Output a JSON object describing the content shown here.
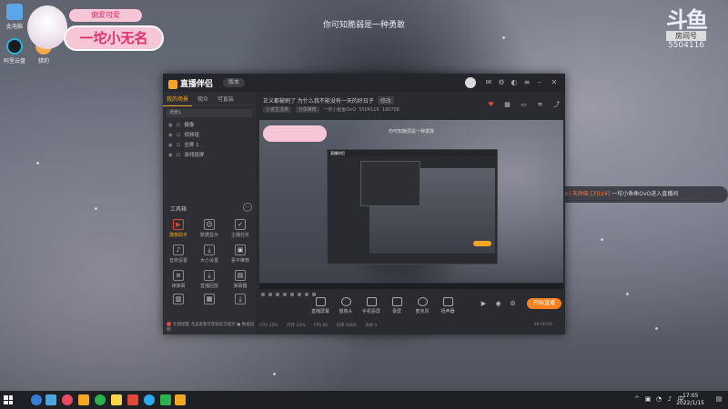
{
  "desktop": {
    "icons": [
      {
        "label": "此电脑"
      },
      {
        "label": "阿里云盘"
      },
      {
        "label": "猎豹"
      }
    ],
    "caption": "你可知脆弱是一种勇敢",
    "streamer_banner": {
      "name": "一坨小无名",
      "tag": "偏爱可爱"
    },
    "douyu": {
      "logo": "斗鱼",
      "label": "房间号",
      "room_number": "5504116"
    },
    "chat": {
      "prefix": "欢迎",
      "user": "[ksb] 天命喵 [3]LV4]",
      "message": "一坨小鱼鱼OvO进入直播间"
    }
  },
  "app": {
    "title": "直播伴侣",
    "version": "版本",
    "left_tabs": [
      "我的场景",
      "观众",
      "可直装"
    ],
    "scene": "场景1",
    "sources": [
      "摄像",
      "视频组",
      "全屏 1",
      "游戏投屏"
    ],
    "tools_title": "工具箱",
    "tools_more": "···",
    "tools": [
      {
        "label": "摄像助手",
        "glyph": "▶"
      },
      {
        "label": "数据显示",
        "glyph": "☺"
      },
      {
        "label": "主播任务",
        "glyph": "✓"
      },
      {
        "label": "音效设置",
        "glyph": "♪"
      },
      {
        "label": "大小设置",
        "glyph": "⤓"
      },
      {
        "label": "看平推荐",
        "glyph": "▣"
      },
      {
        "label": "读弹幕",
        "glyph": "≡"
      },
      {
        "label": "直播回放",
        "glyph": "⤓"
      },
      {
        "label": "弹幕器",
        "glyph": "▤"
      },
      {
        "label": "",
        "glyph": "▥"
      },
      {
        "label": "",
        "glyph": "▦"
      },
      {
        "label": "",
        "glyph": "⤓"
      }
    ],
    "notice": "礼物提醒 点击查看可获取前方提示 ● 数据说明",
    "room_title": "正义都被刷了 为什么我不能没有一天的好日子",
    "edit": "修改",
    "room_tags": [
      "小说生活类",
      "分享推荐"
    ],
    "room_meta": [
      "一坨小鱼鱼OvO",
      "5504116",
      "190706"
    ],
    "preview_title": "你可知脆弱是一种勇敢",
    "controls": [
      {
        "label": "直播屏幕"
      },
      {
        "label": "摄像头"
      },
      {
        "label": "手机投屏"
      },
      {
        "label": "录屏"
      },
      {
        "label": "麦克风"
      },
      {
        "label": "扬声器"
      }
    ],
    "start_label": "开始直播",
    "status": [
      "CPU 15%",
      "内存 33%",
      "FPS 60",
      "码率 5000",
      "丢帧 0",
      "00:00:00"
    ]
  },
  "taskbar": {
    "time": "17:05",
    "date": "2022/1/15"
  },
  "colors": {
    "accent": "#f5a623",
    "live_button": "#f5821f",
    "pink": "#f6c6d6",
    "chat_user": "#f07c3a"
  }
}
